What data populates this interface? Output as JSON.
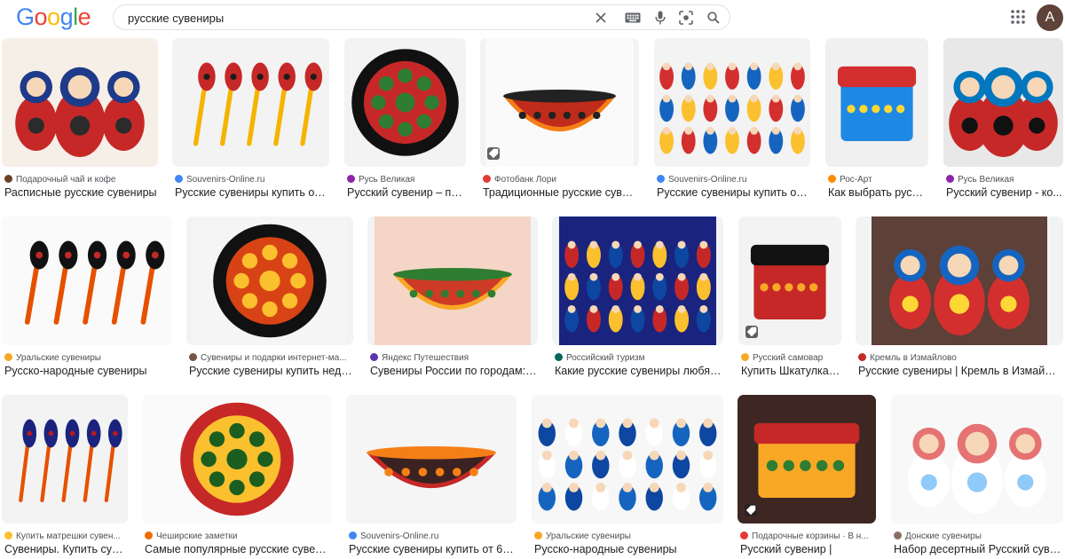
{
  "header": {
    "logo_letters": [
      "G",
      "o",
      "o",
      "g",
      "l",
      "e"
    ],
    "logo_colors": [
      "#4285f4",
      "#ea4335",
      "#fbbc05",
      "#4285f4",
      "#34a853",
      "#ea4335"
    ],
    "search_value": "русские сувениры",
    "avatar_letter": "A",
    "icons": [
      "clear-icon",
      "keyboard-icon",
      "mic-icon",
      "lens-icon",
      "search-icon",
      "apps-icon"
    ]
  },
  "results": [
    {
      "source": "Подарочный чай и кофе",
      "title": "Расписные русские сувениры",
      "favicon": "#6b4226",
      "palette": [
        "#f5efe8",
        "#c62828",
        "#1e3a8a",
        "#2b2b2b"
      ]
    },
    {
      "source": "Souvenirs-Online.ru",
      "title": "Русские сувениры купить от ...",
      "favicon": "#4285f4",
      "palette": [
        "#f3f3f3",
        "#c62828",
        "#f4b400",
        "#1b1b1b"
      ]
    },
    {
      "source": "Русь Великая",
      "title": "Русский сувенир – по...",
      "favicon": "#8e24aa",
      "palette": [
        "#f3f3f3",
        "#111111",
        "#c62828",
        "#2e7d32"
      ]
    },
    {
      "source": "Фотобанк Лори",
      "title": "Традиционные русские сувен...",
      "favicon": "#e53935",
      "palette": [
        "#fafafa",
        "#b71c1c",
        "#f57f17",
        "#222222"
      ]
    },
    {
      "source": "Souvenirs-Online.ru",
      "title": "Русские сувениры купить от ...",
      "favicon": "#4285f4",
      "palette": [
        "#f3f3f3",
        "#d32f2f",
        "#1565c0",
        "#fbc02d"
      ]
    },
    {
      "source": "Рос-Арт",
      "title": "Как выбрать русск...",
      "favicon": "#fb8c00",
      "palette": [
        "#f0f0f0",
        "#d32f2f",
        "#1e88e5",
        "#fdd835"
      ]
    },
    {
      "source": "Русь Великая",
      "title": "Русский сувенир - ко...",
      "favicon": "#8e24aa",
      "palette": [
        "#e8e8e8",
        "#c62828",
        "#0277bd",
        "#111111"
      ]
    },
    {
      "source": "Уральские сувениры",
      "title": "Русско-народные сувениры",
      "favicon": "#f9a825",
      "palette": [
        "#fafafa",
        "#111111",
        "#e65100",
        "#c62828"
      ]
    },
    {
      "source": "Сувениры и подарки интернет-ма...",
      "title": "Русские сувениры купить недо...",
      "favicon": "#795548",
      "palette": [
        "#f5f5f5",
        "#111111",
        "#d84315",
        "#fbc02d"
      ]
    },
    {
      "source": "Яндекс Путешествия",
      "title": "Сувениры России по городам: ч...",
      "favicon": "#5e35b1",
      "palette": [
        "#f5d6c6",
        "#c62828",
        "#f9a825",
        "#2e7d32"
      ]
    },
    {
      "source": "Российский туризм",
      "title": "Какие русские сувениры любят ...",
      "favicon": "#00695c",
      "palette": [
        "#1a237e",
        "#c62828",
        "#fbc02d",
        "#0d47a1"
      ]
    },
    {
      "source": "Русский самовар",
      "title": "Купить Шкатулка ...",
      "favicon": "#f9a825",
      "palette": [
        "#f3f3f3",
        "#111111",
        "#c62828",
        "#f9a825"
      ]
    },
    {
      "source": "Кремль в Измайлово",
      "title": "Русские сувениры | Кремль в Измайлово",
      "favicon": "#c62828",
      "palette": [
        "#5d4037",
        "#d32f2f",
        "#1565c0",
        "#fdd835"
      ]
    },
    {
      "source": "Купить матрешки сувен...",
      "title": "Сувениры. Купить сув...",
      "favicon": "#fbc02d",
      "palette": [
        "#f3f3f3",
        "#1a237e",
        "#e65100",
        "#b71c1c"
      ]
    },
    {
      "source": "Чеширские заметки",
      "title": "Самые популярные русские сувени...",
      "favicon": "#ef6c00",
      "palette": [
        "#fafafa",
        "#c62828",
        "#fbc02d",
        "#1b5e20"
      ]
    },
    {
      "source": "Souvenirs-Online.ru",
      "title": "Русские сувениры купить от 6 р...",
      "favicon": "#4285f4",
      "palette": [
        "#f5f5f5",
        "#212121",
        "#c62828",
        "#f57f17"
      ]
    },
    {
      "source": "Уральские сувениры",
      "title": "Русско-народные сувениры",
      "favicon": "#f9a825",
      "palette": [
        "#f7f7f7",
        "#0d47a1",
        "#ffffff",
        "#1565c0"
      ]
    },
    {
      "source": "Подарочные корзины · В н...",
      "title": "Русский сувенир |",
      "favicon": "#e53935",
      "palette": [
        "#3e2723",
        "#c62828",
        "#f9a825",
        "#2e7d32"
      ]
    },
    {
      "source": "Донские сувениры",
      "title": "Набор десертный Русский суве...",
      "favicon": "#8d6e63",
      "palette": [
        "#f8f8f8",
        "#ffffff",
        "#e57373",
        "#90caf9"
      ]
    }
  ]
}
